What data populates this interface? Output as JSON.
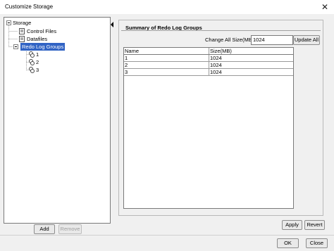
{
  "window": {
    "title": "Customize Storage"
  },
  "tree": {
    "root": "Storage",
    "items": [
      "Control Files",
      "Datafiles",
      "Redo Log Groups"
    ],
    "groups": [
      "1",
      "2",
      "3"
    ]
  },
  "left_buttons": {
    "add": "Add",
    "remove": "Remove"
  },
  "panel": {
    "title": "Summary of Redo Log Groups",
    "change_label": "Change All Size(MB):",
    "change_value": "1024",
    "update_all": "Update All"
  },
  "table": {
    "columns": [
      "Name",
      "Size(MB)"
    ],
    "rows": [
      {
        "name": "1",
        "size": "1024"
      },
      {
        "name": "2",
        "size": "1024"
      },
      {
        "name": "3",
        "size": "1024"
      }
    ]
  },
  "buttons": {
    "apply": "Apply",
    "revert": "Revert",
    "ok": "OK",
    "close": "Close"
  }
}
